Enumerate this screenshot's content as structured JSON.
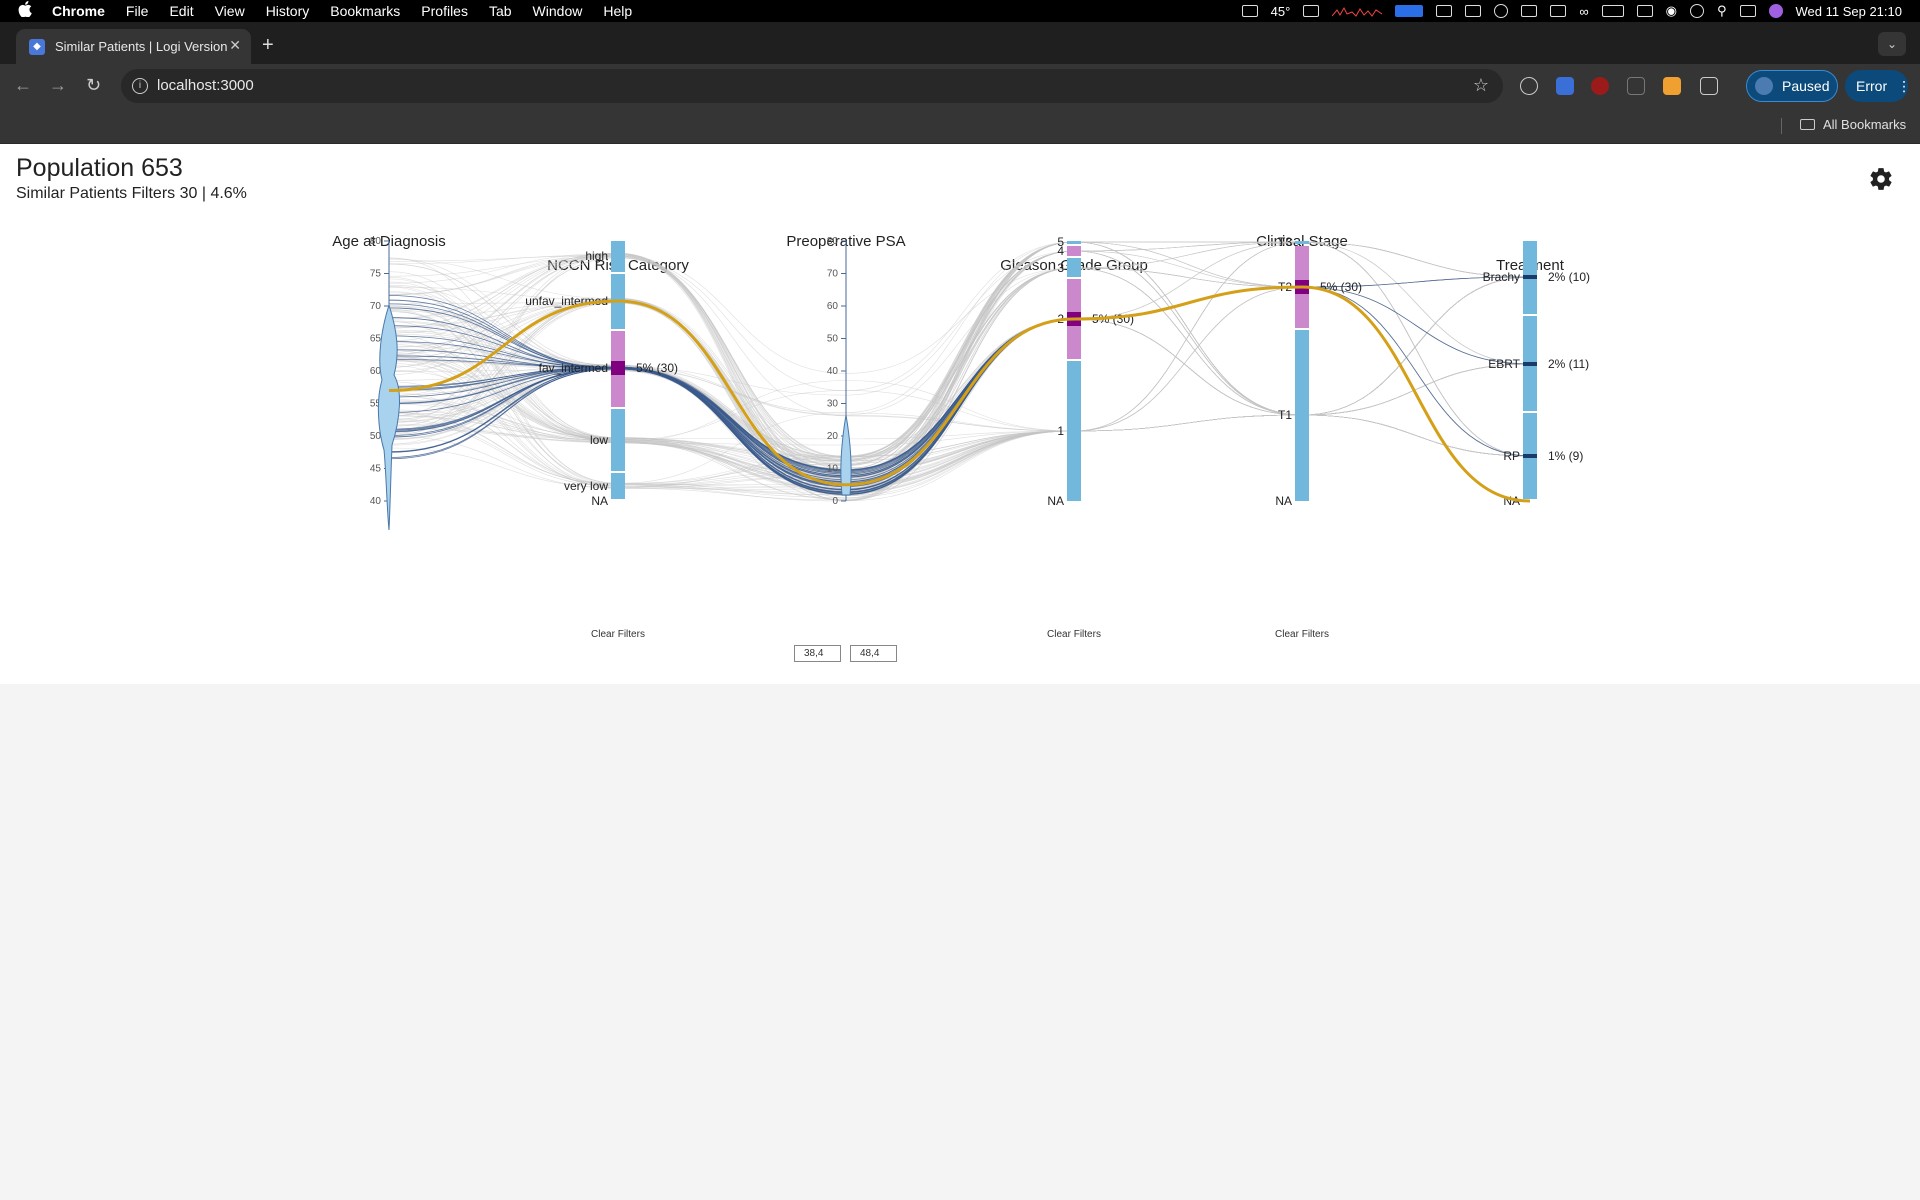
{
  "menubar": {
    "app": "Chrome",
    "items": [
      "File",
      "Edit",
      "View",
      "History",
      "Bookmarks",
      "Profiles",
      "Tab",
      "Window",
      "Help"
    ],
    "temperature": "45°",
    "datetime": "Wed 11 Sep  21:10"
  },
  "browser": {
    "tab_title": "Similar Patients | Logi Version",
    "url": "localhost:3000",
    "paused_label": "Paused",
    "error_label": "Error",
    "bookmarks_label": "All Bookmarks"
  },
  "page": {
    "population_title": "Population 653",
    "filter_summary": "Similar Patients Filters 30 | 4.6%",
    "psa_range_min": "38,4",
    "psa_range_max": "48,4",
    "clear_filters_label": "Clear Filters"
  },
  "chart_data": {
    "type": "parallel-coordinates",
    "highlight_color": "#d4a017",
    "selected_line_color": "#3a5a8c",
    "bar_color": "#72b7dc",
    "selected_bar_color": "#cc88cc",
    "marker_color": "#800080",
    "axes": [
      {
        "name": "Age at Diagnosis",
        "kind": "numeric",
        "range": [
          40,
          80
        ],
        "ticks": [
          40,
          45,
          50,
          55,
          60,
          65,
          70,
          75,
          80
        ]
      },
      {
        "name": "NCCN Risk Category",
        "kind": "categorical",
        "categories": [
          "high",
          "unfav_intermed",
          "fav_intermed",
          "low",
          "very low",
          "NA"
        ],
        "selected": "fav_intermed",
        "selected_label": "5% (30)"
      },
      {
        "name": "Preoperative PSA",
        "kind": "numeric",
        "range": [
          0,
          80
        ],
        "ticks": [
          0,
          10,
          20,
          30,
          40,
          50,
          60,
          70,
          80
        ]
      },
      {
        "name": "Gleason Grade Group",
        "kind": "categorical",
        "categories": [
          "5",
          "4",
          "3",
          "2",
          "1",
          "NA"
        ],
        "selected": "2",
        "selected_label": "5% (30)"
      },
      {
        "name": "Clinical Stage",
        "kind": "categorical",
        "categories": [
          "T3",
          "T2",
          "T1",
          "NA"
        ],
        "selected": "T2",
        "selected_label": "5% (30)"
      },
      {
        "name": "Treatment",
        "kind": "categorical",
        "categories": [
          "Brachy",
          "EBRT",
          "RP",
          "NA"
        ],
        "labels": [
          "2% (10)",
          "2% (11)",
          "1% (9)",
          ""
        ]
      }
    ],
    "highlighted_patient": {
      "age": 57,
      "nccn": "unfav_intermed",
      "psa": 5,
      "gleason": "2",
      "stage": "T2",
      "treatment": "NA"
    }
  }
}
